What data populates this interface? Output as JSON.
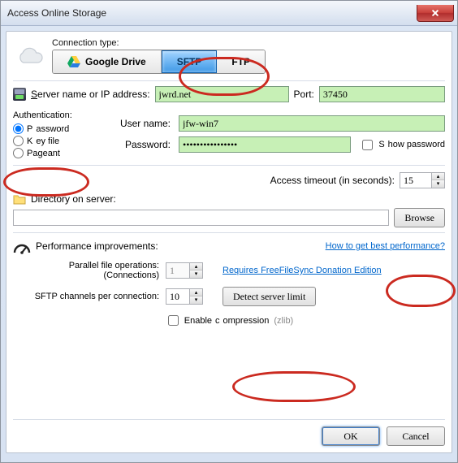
{
  "window": {
    "title": "Access Online Storage"
  },
  "connection": {
    "label": "Connection type:",
    "options": {
      "gdrive": "Google Drive",
      "sftp": "SFTP",
      "ftp": "FTP"
    }
  },
  "server": {
    "label": "Server name or IP address:",
    "value": "jwrd.net",
    "port_label": "Port:",
    "port_value": "37450"
  },
  "auth": {
    "heading": "Authentication:",
    "password": "Password",
    "keyfile": "Key file",
    "pageant": "Pageant"
  },
  "creds": {
    "user_label": "User name:",
    "user_value": "jfw-win7",
    "pw_label": "Password:",
    "pw_value": "••••••••••••••••",
    "show_pw": "Show password"
  },
  "timeout": {
    "label": "Access timeout (in seconds):",
    "value": "15"
  },
  "directory": {
    "label": "Directory on server:",
    "value": "",
    "browse": "Browse"
  },
  "perf": {
    "heading": "Performance improvements:",
    "help_link": "How to get best performance?",
    "pfo_label_1": "Parallel file operations:",
    "pfo_label_2": "(Connections)",
    "pfo_value": "1",
    "pfo_link": "Requires FreeFileSync Donation Edition",
    "chan_label": "SFTP channels per connection:",
    "chan_value": "10",
    "detect": "Detect server limit",
    "compress": "Enable compression",
    "zlib": "(zlib)"
  },
  "footer": {
    "ok": "OK",
    "cancel": "Cancel"
  }
}
